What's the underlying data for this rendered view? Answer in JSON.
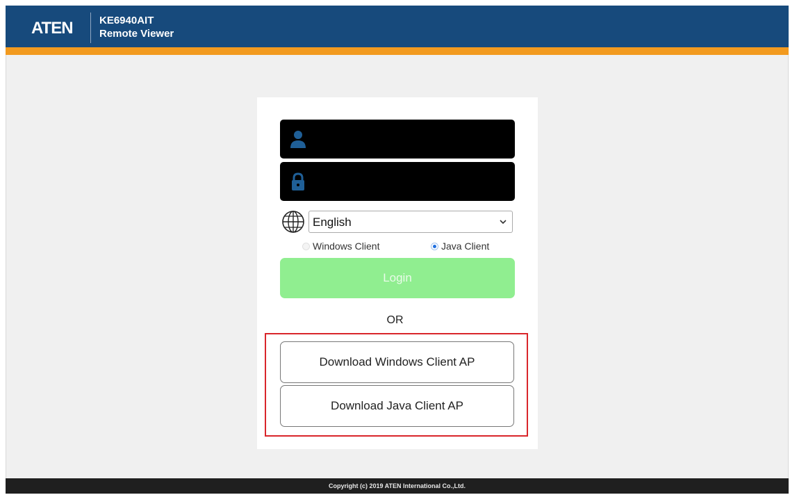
{
  "header": {
    "logo": "ATEN",
    "product_model": "KE6940AIT",
    "product_name": "Remote Viewer"
  },
  "login_form": {
    "username_icon": "user-icon",
    "password_icon": "lock-icon",
    "language_icon": "globe-icon",
    "language_selected": "English",
    "client_options": [
      {
        "label": "Windows Client",
        "selected": false
      },
      {
        "label": "Java Client",
        "selected": true
      }
    ],
    "login_label": "Login",
    "login_color": "#90ee90",
    "or_text": "OR"
  },
  "downloads": {
    "windows_label": "Download Windows Client AP",
    "java_label": "Download Java Client AP",
    "highlight_color": "#d9252a"
  },
  "colors": {
    "header_bg": "#174a7c",
    "accent_bar": "#f29a1f",
    "footer_bg": "#1f1f1f"
  },
  "footer": {
    "copyright": "Copyright (c) 2019 ATEN International Co.,Ltd."
  }
}
